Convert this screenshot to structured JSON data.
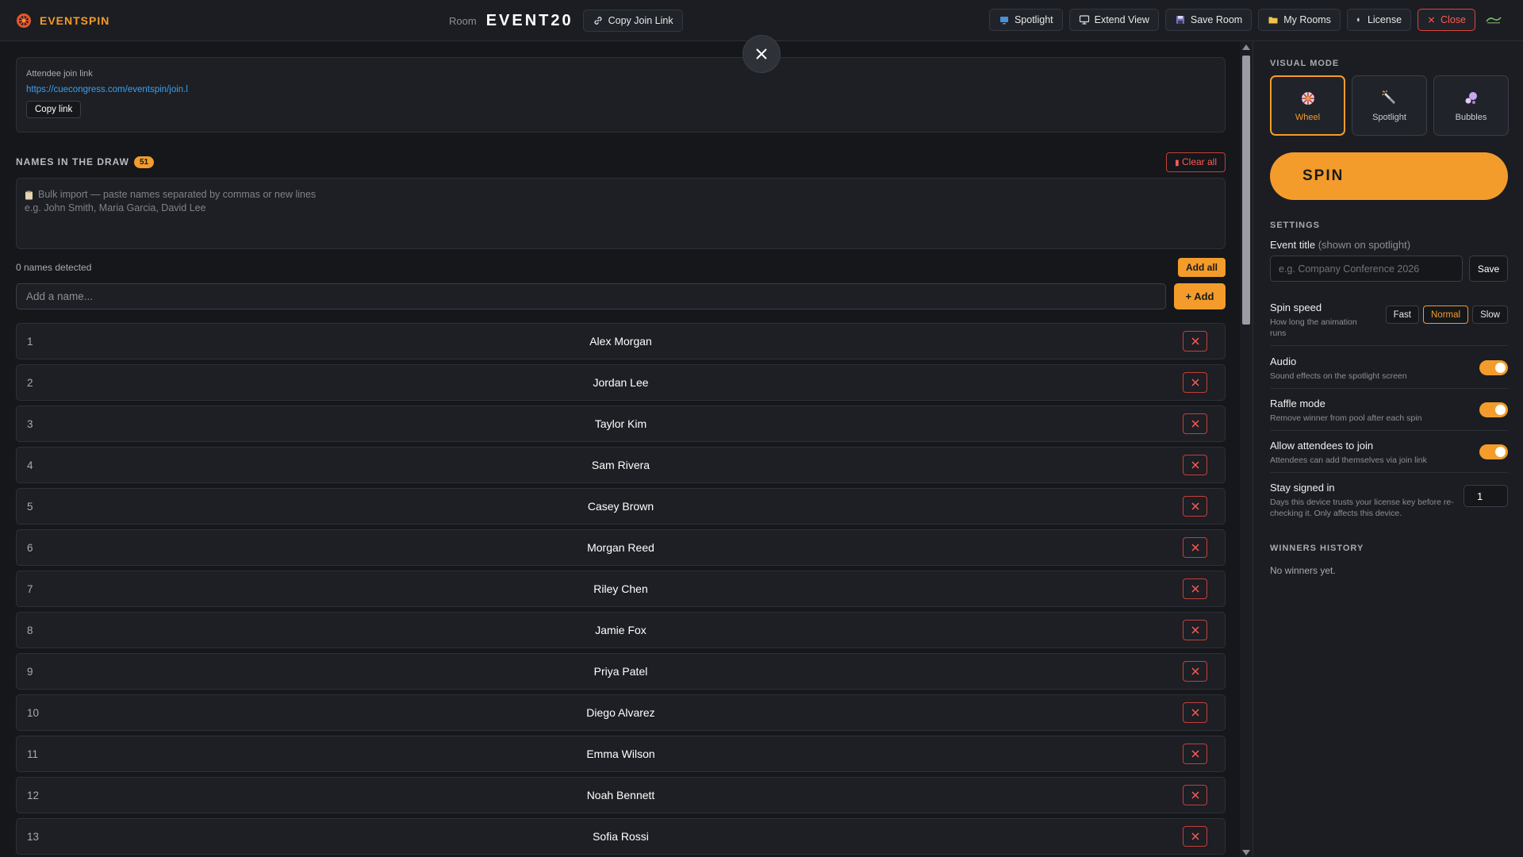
{
  "brand": {
    "name": "EVENTSPIN"
  },
  "room": {
    "label": "Room",
    "code": "EVENT20",
    "copy_join_label": "Copy Join Link"
  },
  "actions": {
    "spotlight": "Spotlight",
    "extend_view": "Extend View",
    "save_room": "Save Room",
    "my_rooms": "My Rooms",
    "license": "License",
    "close": "Close"
  },
  "join": {
    "label": "Attendee join link",
    "url": "https://cuecongress.com/eventspin/join.l",
    "copy_label": "Copy link"
  },
  "draw": {
    "title": "NAMES IN THE DRAW",
    "count": "51",
    "clear_label": "Clear all",
    "bulk_hint": "Bulk import — paste names separated by commas or new lines",
    "bulk_example": "e.g. John Smith, Maria Garcia, David Lee",
    "detected": "0 names detected",
    "add_all_label": "Add all",
    "add_placeholder": "Add a name...",
    "add_label": "+ Add",
    "names": [
      {
        "num": "1",
        "name": "Alex Morgan"
      },
      {
        "num": "2",
        "name": "Jordan Lee"
      },
      {
        "num": "3",
        "name": "Taylor Kim"
      },
      {
        "num": "4",
        "name": "Sam Rivera"
      },
      {
        "num": "5",
        "name": "Casey Brown"
      },
      {
        "num": "6",
        "name": "Morgan Reed"
      },
      {
        "num": "7",
        "name": "Riley Chen"
      },
      {
        "num": "8",
        "name": "Jamie Fox"
      },
      {
        "num": "9",
        "name": "Priya Patel"
      },
      {
        "num": "10",
        "name": "Diego Alvarez"
      },
      {
        "num": "11",
        "name": "Emma Wilson"
      },
      {
        "num": "12",
        "name": "Noah Bennett"
      },
      {
        "num": "13",
        "name": "Sofia Rossi"
      }
    ]
  },
  "sidebar": {
    "visual_mode_title": "VISUAL MODE",
    "modes": [
      {
        "label": "Wheel",
        "active": true
      },
      {
        "label": "Spotlight",
        "active": false
      },
      {
        "label": "Bubbles",
        "active": false
      }
    ],
    "spin_label": "SPIN",
    "settings_title": "SETTINGS",
    "event_title_label": "Event title",
    "event_title_note": "(shown on spotlight)",
    "event_title_placeholder": "e.g. Company Conference 2026",
    "save_label": "Save",
    "spin_speed": {
      "title": "Spin speed",
      "desc": "How long the animation runs",
      "options": [
        "Fast",
        "Normal",
        "Slow"
      ],
      "selected": "Normal"
    },
    "audio": {
      "title": "Audio",
      "desc": "Sound effects on the spotlight screen",
      "on": true
    },
    "raffle": {
      "title": "Raffle mode",
      "desc": "Remove winner from pool after each spin",
      "on": true
    },
    "allow_join": {
      "title": "Allow attendees to join",
      "desc": "Attendees can add themselves via join link",
      "on": true
    },
    "stay_signed": {
      "title": "Stay signed in",
      "desc": "Days this device trusts your license key before re-checking it. Only affects this device.",
      "value": "1"
    },
    "winners_title": "WINNERS HISTORY",
    "no_winners": "No winners yet."
  },
  "colors": {
    "accent": "#f39c2b",
    "danger": "#ff5a52",
    "link": "#3ba0f2",
    "background": "#15171b"
  }
}
